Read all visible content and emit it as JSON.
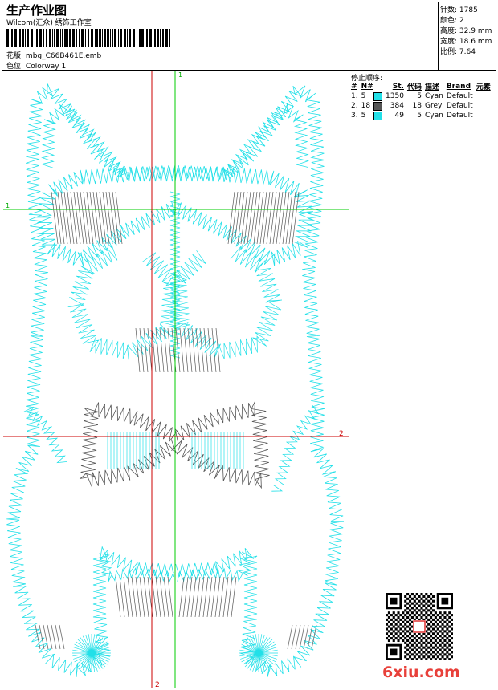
{
  "header": {
    "title": "生产作业图",
    "studio": "Wilcom(汇众) 绣饰工作室",
    "design_label": "花版:",
    "design_name": "mbg_C66B461E.emb",
    "colorway_label": "色位:",
    "colorway_name": "Colorway 1"
  },
  "stats": [
    {
      "label": "针数:",
      "value": "1785"
    },
    {
      "label": "颜色:",
      "value": "2"
    },
    {
      "label": "高度:",
      "value": "32.9 mm"
    },
    {
      "label": "宽度:",
      "value": "18.6 mm"
    },
    {
      "label": "比例:",
      "value": "7.64"
    }
  ],
  "stop_sequence": {
    "title": "停止顺序:",
    "columns": [
      "#",
      "N#",
      "St.",
      "代码",
      "描述",
      "Brand",
      "元素"
    ],
    "rows": [
      {
        "idx": "1.",
        "n": "5",
        "color": "#22e0e8",
        "st": "1350",
        "code": "5",
        "desc": "Cyan",
        "brand": "Default"
      },
      {
        "idx": "2.",
        "n": "18",
        "color": "#555555",
        "st": "384",
        "code": "18",
        "desc": "Grey",
        "brand": "Default"
      },
      {
        "idx": "3.",
        "n": "5",
        "color": "#22e0e8",
        "st": "49",
        "code": "5",
        "desc": "Cyan",
        "brand": "Default"
      }
    ]
  },
  "crosshair": {
    "v1_label": "1",
    "h1_label": "1",
    "h2_label": "2",
    "v2_label": "2"
  },
  "watermark": "6xiu.com",
  "colors": {
    "cyan": "#22e0e8",
    "grey": "#555555",
    "green": "#00cc00",
    "red": "#cc0000"
  }
}
